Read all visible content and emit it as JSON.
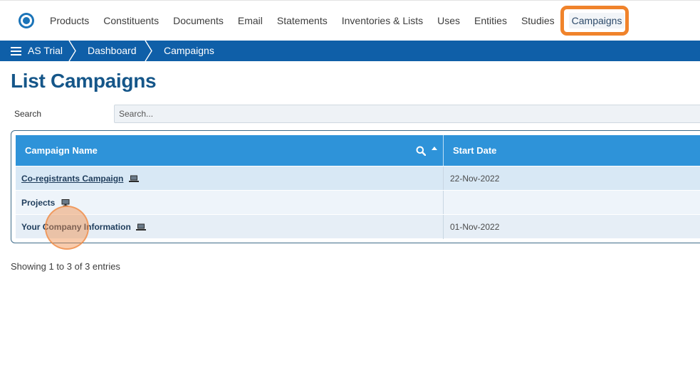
{
  "nav": {
    "items": [
      {
        "label": "Products"
      },
      {
        "label": "Constituents"
      },
      {
        "label": "Documents"
      },
      {
        "label": "Email"
      },
      {
        "label": "Statements"
      },
      {
        "label": "Inventories & Lists"
      },
      {
        "label": "Uses"
      },
      {
        "label": "Entities"
      },
      {
        "label": "Studies"
      },
      {
        "label": "Campaigns"
      }
    ],
    "active_index": 9,
    "highlight_color": "#f0832b"
  },
  "breadcrumb": {
    "items": [
      "AS Trial",
      "Dashboard",
      "Campaigns"
    ],
    "bar_color": "#0f5fa8"
  },
  "page": {
    "title": "List Campaigns",
    "search_label": "Search",
    "search_placeholder": "Search...",
    "search_value": ""
  },
  "table": {
    "columns": [
      "Campaign Name",
      "Start Date"
    ],
    "header_color": "#2e93d9",
    "rows": [
      {
        "name": "Co-registrants Campaign",
        "start_date": "22-Nov-2022",
        "linked": true,
        "icon": "laptop-icon"
      },
      {
        "name": "Projects",
        "start_date": "",
        "linked": false,
        "icon": "monitor-icon"
      },
      {
        "name": "Your Company Information",
        "start_date": "01-Nov-2022",
        "linked": false,
        "icon": "laptop-icon"
      }
    ],
    "info": "Showing 1 to 3 of 3 entries"
  },
  "accent_colors": {
    "title": "#155689",
    "click_marker": "#f08c46"
  }
}
